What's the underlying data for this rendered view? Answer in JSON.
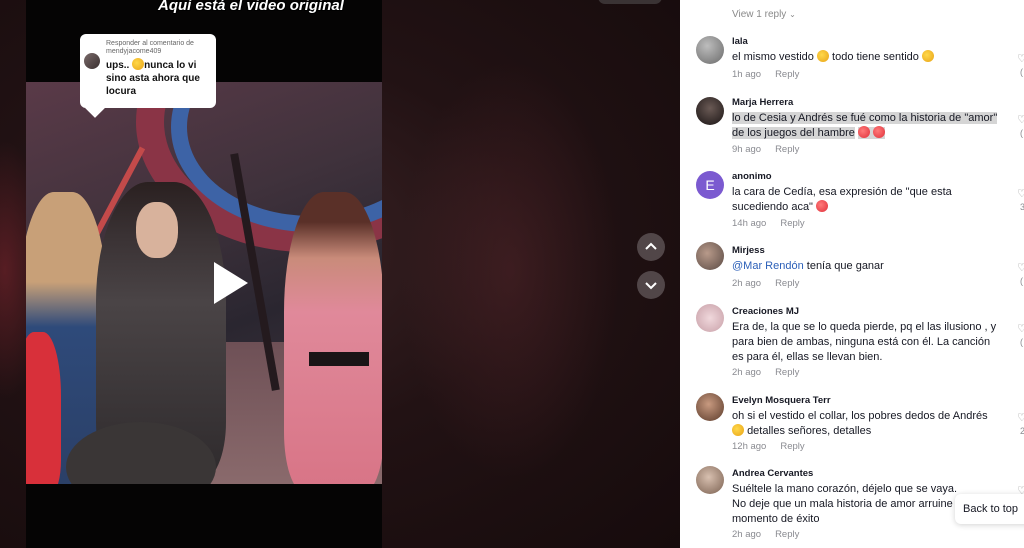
{
  "video": {
    "overlay_title": "Aquí está el video original",
    "reply_bubble": {
      "header_line1": "Responder al comentario de",
      "header_line2": "mendyjacome409",
      "text_line1": "ups.. ",
      "text_line1_rest": "nunca lo vi",
      "text_line2": "sino asta ahora que",
      "text_line3": "locura"
    }
  },
  "comments_panel": {
    "view_reply": "View 1 reply",
    "reply_label": "Reply",
    "comments": [
      {
        "user": "lala",
        "text": "el mismo vestido",
        "text_after": "todo tiene sentido",
        "time": "1h ago"
      },
      {
        "user": "Marja Herrera",
        "text": "lo de Cesia y Andrés se fué como la historia de \"amor\" de los juegos del hambre",
        "time": "9h ago"
      },
      {
        "user": "anonimo",
        "avatar_letter": "E",
        "text": "la cara de Cedía, esa expresión de \"que esta sucediendo aca\"",
        "time": "14h ago"
      },
      {
        "user": "Mirjess",
        "mention": "@Mar Rendón",
        "text": "tenía que ganar",
        "time": "2h ago"
      },
      {
        "user": "Creaciones MJ",
        "text": "Era de, la que se lo queda pierde, pq el las ilusiono , y para bien de ambas, ninguna está con él. La canción es para él, ellas se llevan bien.",
        "time": "2h ago"
      },
      {
        "user": "Evelyn Mosquera Terr",
        "text_line1": "oh si el vestido el collar, los pobres dedos de Andrés",
        "text_line2": "detalles señores, detalles",
        "time": "12h ago"
      },
      {
        "user": "Andrea Cervantes",
        "text": "Suéltele la mano corazón, déjelo que se vaya. No deje que un mala historia de amor arruine su momento de éxito",
        "time": "2h ago"
      }
    ],
    "like_counts": [
      "(",
      "(",
      "3",
      "(",
      "(",
      "2",
      ""
    ]
  },
  "back_to_top": "Back to top",
  "colors": {
    "mention": "#2b5fb8",
    "avatar_letter_bg": "#7b5ad0",
    "meta_gray": "#8a8b91"
  }
}
